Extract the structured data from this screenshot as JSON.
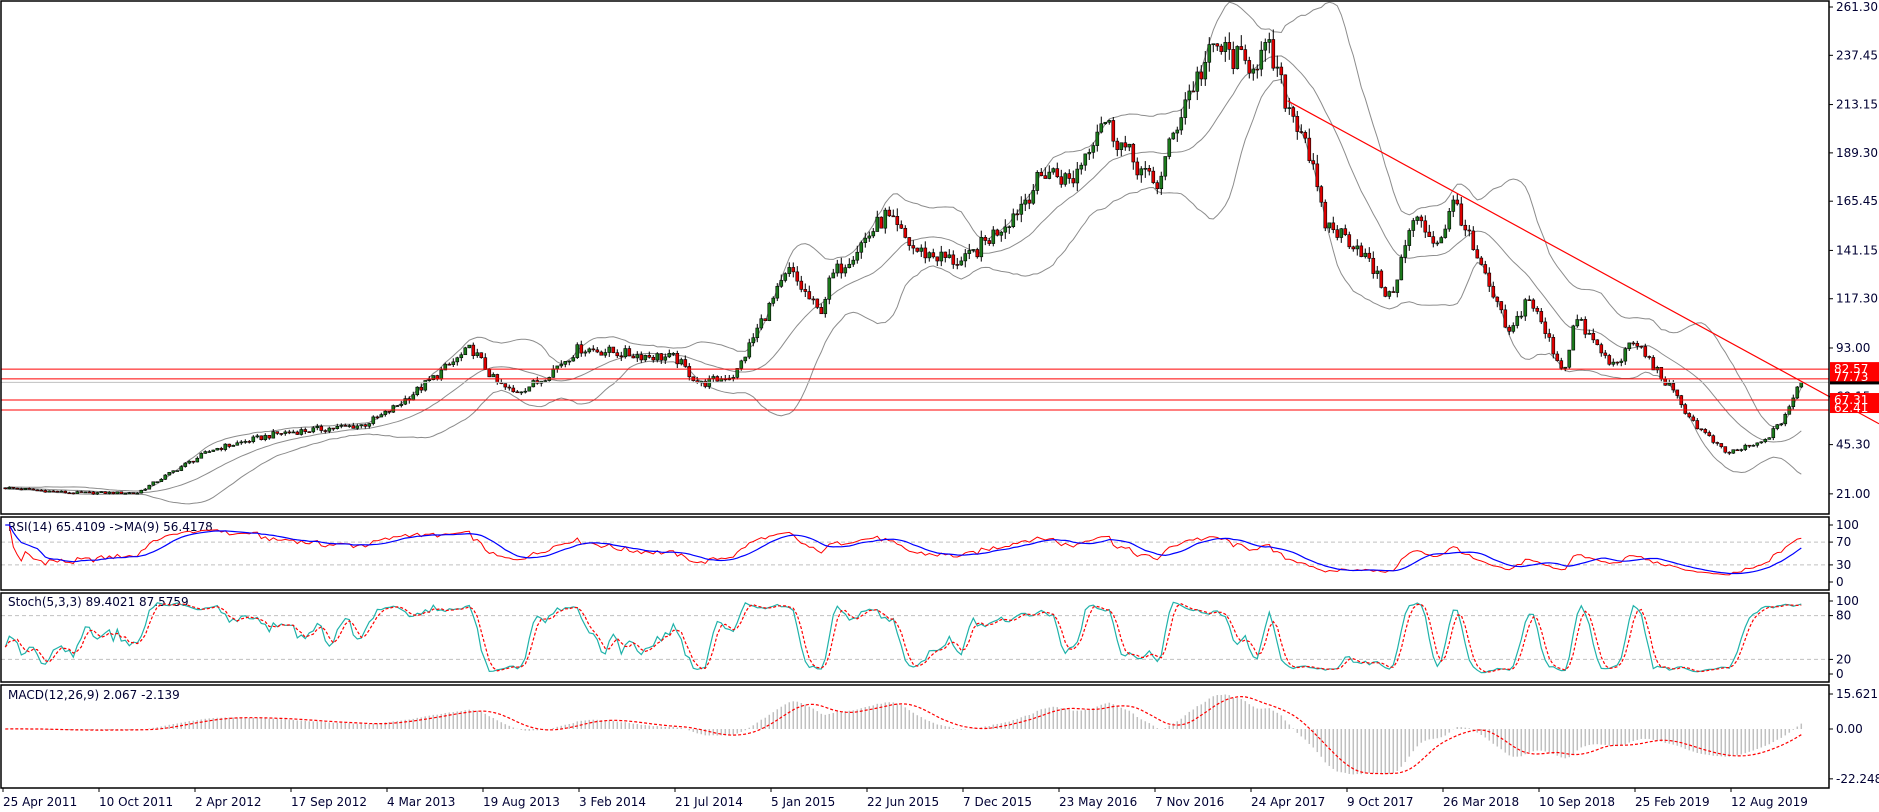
{
  "chart_data": [
    {
      "type": "candlestick",
      "title": "",
      "overlays": [
        "bollinger-bands"
      ],
      "price_axis_ticks": [
        "261.30",
        "237.45",
        "213.15",
        "189.30",
        "165.45",
        "141.15",
        "117.30",
        "93.00",
        "69.15",
        "45.30",
        "21.00"
      ],
      "ylim": [
        21.0,
        261.3
      ],
      "date_axis_ticks": [
        "25 Apr 2011",
        "10 Oct 2011",
        "2 Apr 2012",
        "17 Sep 2012",
        "4 Mar 2013",
        "19 Aug 2013",
        "3 Feb 2014",
        "21 Jul 2014",
        "5 Jan 2015",
        "22 Jun 2015",
        "7 Dec 2015",
        "23 May 2016",
        "7 Nov 2016",
        "24 Apr 2017",
        "9 Oct 2017",
        "26 Mar 2018",
        "10 Sep 2018",
        "25 Feb 2019",
        "12 Aug 2019"
      ],
      "timeframe": "weekly",
      "close_waypoints": [
        {
          "date": "2011-04-29",
          "close": 24
        },
        {
          "date": "2011-08-23",
          "close": 21.5
        },
        {
          "date": "2011-12-16",
          "close": 21.5
        },
        {
          "date": "2012-02-28",
          "close": 34
        },
        {
          "date": "2012-04-27",
          "close": 43
        },
        {
          "date": "2012-08-21",
          "close": 51
        },
        {
          "date": "2013-01-15",
          "close": 55
        },
        {
          "date": "2013-02-25",
          "close": 61
        },
        {
          "date": "2013-04-19",
          "close": 72
        },
        {
          "date": "2013-07-23",
          "close": 93
        },
        {
          "date": "2013-09-03",
          "close": 76
        },
        {
          "date": "2013-10-04",
          "close": 71
        },
        {
          "date": "2013-11-15",
          "close": 76
        },
        {
          "date": "2014-01-28",
          "close": 93
        },
        {
          "date": "2014-04-22",
          "close": 90
        },
        {
          "date": "2014-07-15",
          "close": 88
        },
        {
          "date": "2014-08-26",
          "close": 75
        },
        {
          "date": "2014-10-28",
          "close": 80
        },
        {
          "date": "2014-12-10",
          "close": 105
        },
        {
          "date": "2015-01-30",
          "close": 131
        },
        {
          "date": "2015-03-24",
          "close": 110
        },
        {
          "date": "2015-04-14",
          "close": 128
        },
        {
          "date": "2015-07-17",
          "close": 158
        },
        {
          "date": "2015-09-08",
          "close": 141
        },
        {
          "date": "2015-12-01",
          "close": 135
        },
        {
          "date": "2016-02-23",
          "close": 158
        },
        {
          "date": "2016-04-25",
          "close": 181
        },
        {
          "date": "2016-06-07",
          "close": 175
        },
        {
          "date": "2016-07-30",
          "close": 207
        },
        {
          "date": "2016-09-21",
          "close": 186
        },
        {
          "date": "2016-11-02",
          "close": 172
        },
        {
          "date": "2016-12-23",
          "close": 216
        },
        {
          "date": "2017-02-14",
          "close": 242
        },
        {
          "date": "2017-04-07",
          "close": 233
        },
        {
          "date": "2017-05-19",
          "close": 239
        },
        {
          "date": "2017-06-20",
          "close": 213
        },
        {
          "date": "2017-07-21",
          "close": 198
        },
        {
          "date": "2017-08-22",
          "close": 155
        },
        {
          "date": "2017-10-24",
          "close": 143
        },
        {
          "date": "2017-12-16",
          "close": 117
        },
        {
          "date": "2018-01-27",
          "close": 157
        },
        {
          "date": "2018-03-10",
          "close": 145
        },
        {
          "date": "2018-04-10",
          "close": 166
        },
        {
          "date": "2018-05-12",
          "close": 140
        },
        {
          "date": "2018-07-14",
          "close": 99
        },
        {
          "date": "2018-08-15",
          "close": 119
        },
        {
          "date": "2018-10-16",
          "close": 81
        },
        {
          "date": "2018-11-06",
          "close": 108
        },
        {
          "date": "2019-01-08",
          "close": 84
        },
        {
          "date": "2019-02-19",
          "close": 96
        },
        {
          "date": "2019-04-23",
          "close": 72
        },
        {
          "date": "2019-06-04",
          "close": 55
        },
        {
          "date": "2019-07-27",
          "close": 41
        },
        {
          "date": "2019-09-27",
          "close": 46
        },
        {
          "date": "2019-10-29",
          "close": 55
        },
        {
          "date": "2019-12-06",
          "close": 76
        }
      ],
      "horizontal_levels": [
        {
          "price": 82.57,
          "label": "82.57"
        },
        {
          "price": 77.73,
          "label": "77.73"
        },
        {
          "price": 67.31,
          "label": "67.31"
        },
        {
          "price": 62.41,
          "label": "62.41"
        }
      ],
      "trendline": [
        {
          "date": "2017-06-20",
          "price": 215
        },
        {
          "date": "2020-02-04",
          "price": 67.3
        }
      ],
      "colors": {
        "bull": "#1c7a1c",
        "bear": "#e00000",
        "bands": "#8c8c8c",
        "levels": "#ff0000",
        "tag_bg": "#ff0000"
      }
    },
    {
      "type": "line",
      "title": "RSI(14) 65.4109  ->MA(9) 56.4178",
      "ticks": [
        "100",
        "70",
        "30",
        "0"
      ],
      "ylim": [
        0,
        100
      ],
      "levels": [
        70,
        30
      ],
      "colors": {
        "rsi": "#ff0000",
        "ma": "#0000ff"
      }
    },
    {
      "type": "line",
      "title": "Stoch(5,3,3) 89.4021 87.5759",
      "ticks": [
        "100",
        "80",
        "20",
        "0"
      ],
      "ylim": [
        0,
        100
      ],
      "levels": [
        80,
        20
      ],
      "colors": {
        "main": "#20b2aa",
        "signal": "#ff0000"
      }
    },
    {
      "type": "bar",
      "title": "MACD(12,26,9) 2.067 -2.139",
      "ticks": [
        "15.621",
        "0.00",
        "-22.248"
      ],
      "ylim": [
        -22.248,
        15.621
      ],
      "colors": {
        "histogram": "#c0c0c0",
        "signal": "#ff0000"
      }
    }
  ]
}
